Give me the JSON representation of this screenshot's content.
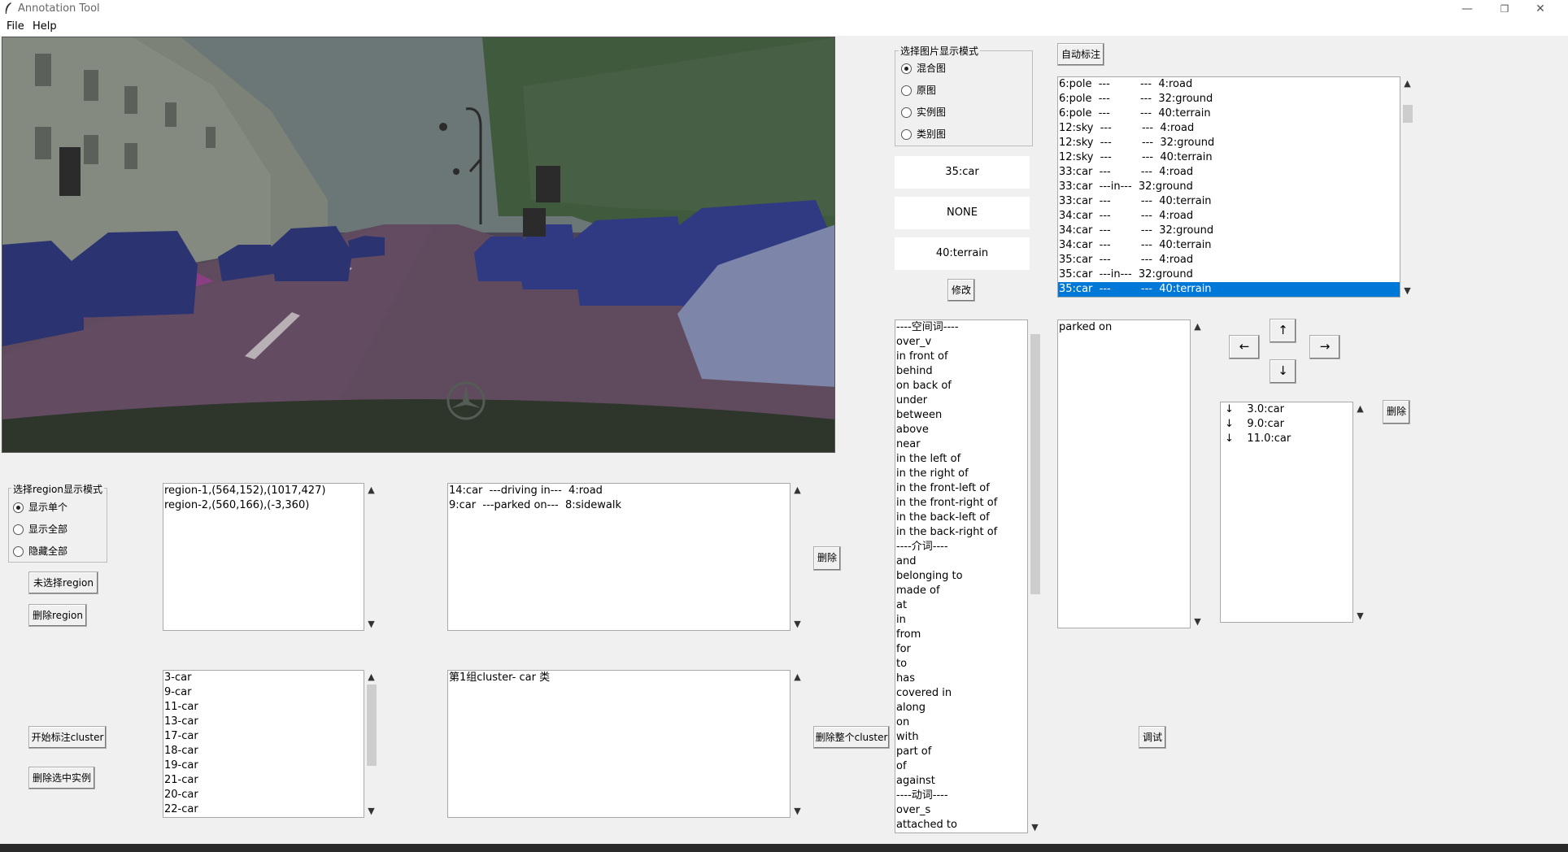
{
  "window": {
    "title": "Annotation Tool",
    "minimize": "—",
    "maximize": "❐",
    "close": "✕"
  },
  "menu": [
    "File",
    "Help"
  ],
  "display_mode": {
    "title": "选择图片显示模式",
    "options": [
      "混合图",
      "原图",
      "实例图",
      "类别图"
    ],
    "selected": 0
  },
  "fields": {
    "subject": "35:car",
    "relation": "NONE",
    "object": "40:terrain",
    "modify_button": "修改"
  },
  "auto_label_button": "自动标注",
  "relations_list": {
    "rows": [
      "6:pole  ---         ---  4:road",
      "6:pole  ---         ---  32:ground",
      "6:pole  ---         ---  40:terrain",
      "12:sky  ---         ---  4:road",
      "12:sky  ---         ---  32:ground",
      "12:sky  ---         ---  40:terrain",
      "33:car  ---         ---  4:road",
      "33:car  ---in---  32:ground",
      "33:car  ---         ---  40:terrain",
      "34:car  ---         ---  4:road",
      "34:car  ---         ---  32:ground",
      "34:car  ---         ---  40:terrain",
      "35:car  ---         ---  4:road",
      "35:car  ---in---  32:ground",
      "35:car  ---         ---  40:terrain"
    ],
    "selected": 14
  },
  "predicates": [
    "----空间词----",
    "over_v",
    "in front of",
    "behind",
    "on back of",
    "under",
    "between",
    "above",
    "near",
    "in the left of",
    "in the right of",
    "in the front-left of",
    "in the front-right of",
    "in the back-left of",
    "in the back-right of",
    "----介词----",
    "and",
    "belonging to",
    "made of",
    "at",
    "in",
    "from",
    "for",
    "to",
    "has",
    "covered in",
    "along",
    "on",
    "with",
    "part of",
    "of",
    "against",
    "----动词----",
    "over_s",
    "attached to"
  ],
  "selected_predicates": [
    "parked on"
  ],
  "arrows": {
    "up": "↑",
    "down": "↓",
    "left": "←",
    "right": "→"
  },
  "instances_list": [
    "↓    3.0:car",
    "↓    9.0:car",
    "↓    11.0:car"
  ],
  "delete_instance_button": "删除",
  "region_mode": {
    "title": "选择region显示模式",
    "options": [
      "显示单个",
      "显示全部",
      "隐藏全部"
    ],
    "selected": 0
  },
  "region_buttons": {
    "unselected": "未选择region",
    "delete": "删除region"
  },
  "regions_list": [
    "region-1,(564,152),(1017,427)",
    "region-2,(560,166),(-3,360)"
  ],
  "region_relations": [
    "14:car  ---driving in---  4:road",
    "9:car  ---parked on---  8:sidewalk"
  ],
  "delete_relation_button": "删除",
  "cluster_buttons": {
    "start": "开始标注cluster",
    "delete_selected": "删除选中实例",
    "delete_cluster": "删除整个cluster"
  },
  "cluster_instances": [
    "3-car",
    "9-car",
    "11-car",
    "13-car",
    "17-car",
    "18-car",
    "19-car",
    "21-car",
    "20-car",
    "22-car"
  ],
  "clusters": [
    "第1组cluster- car 类"
  ],
  "debug_button": "调试"
}
